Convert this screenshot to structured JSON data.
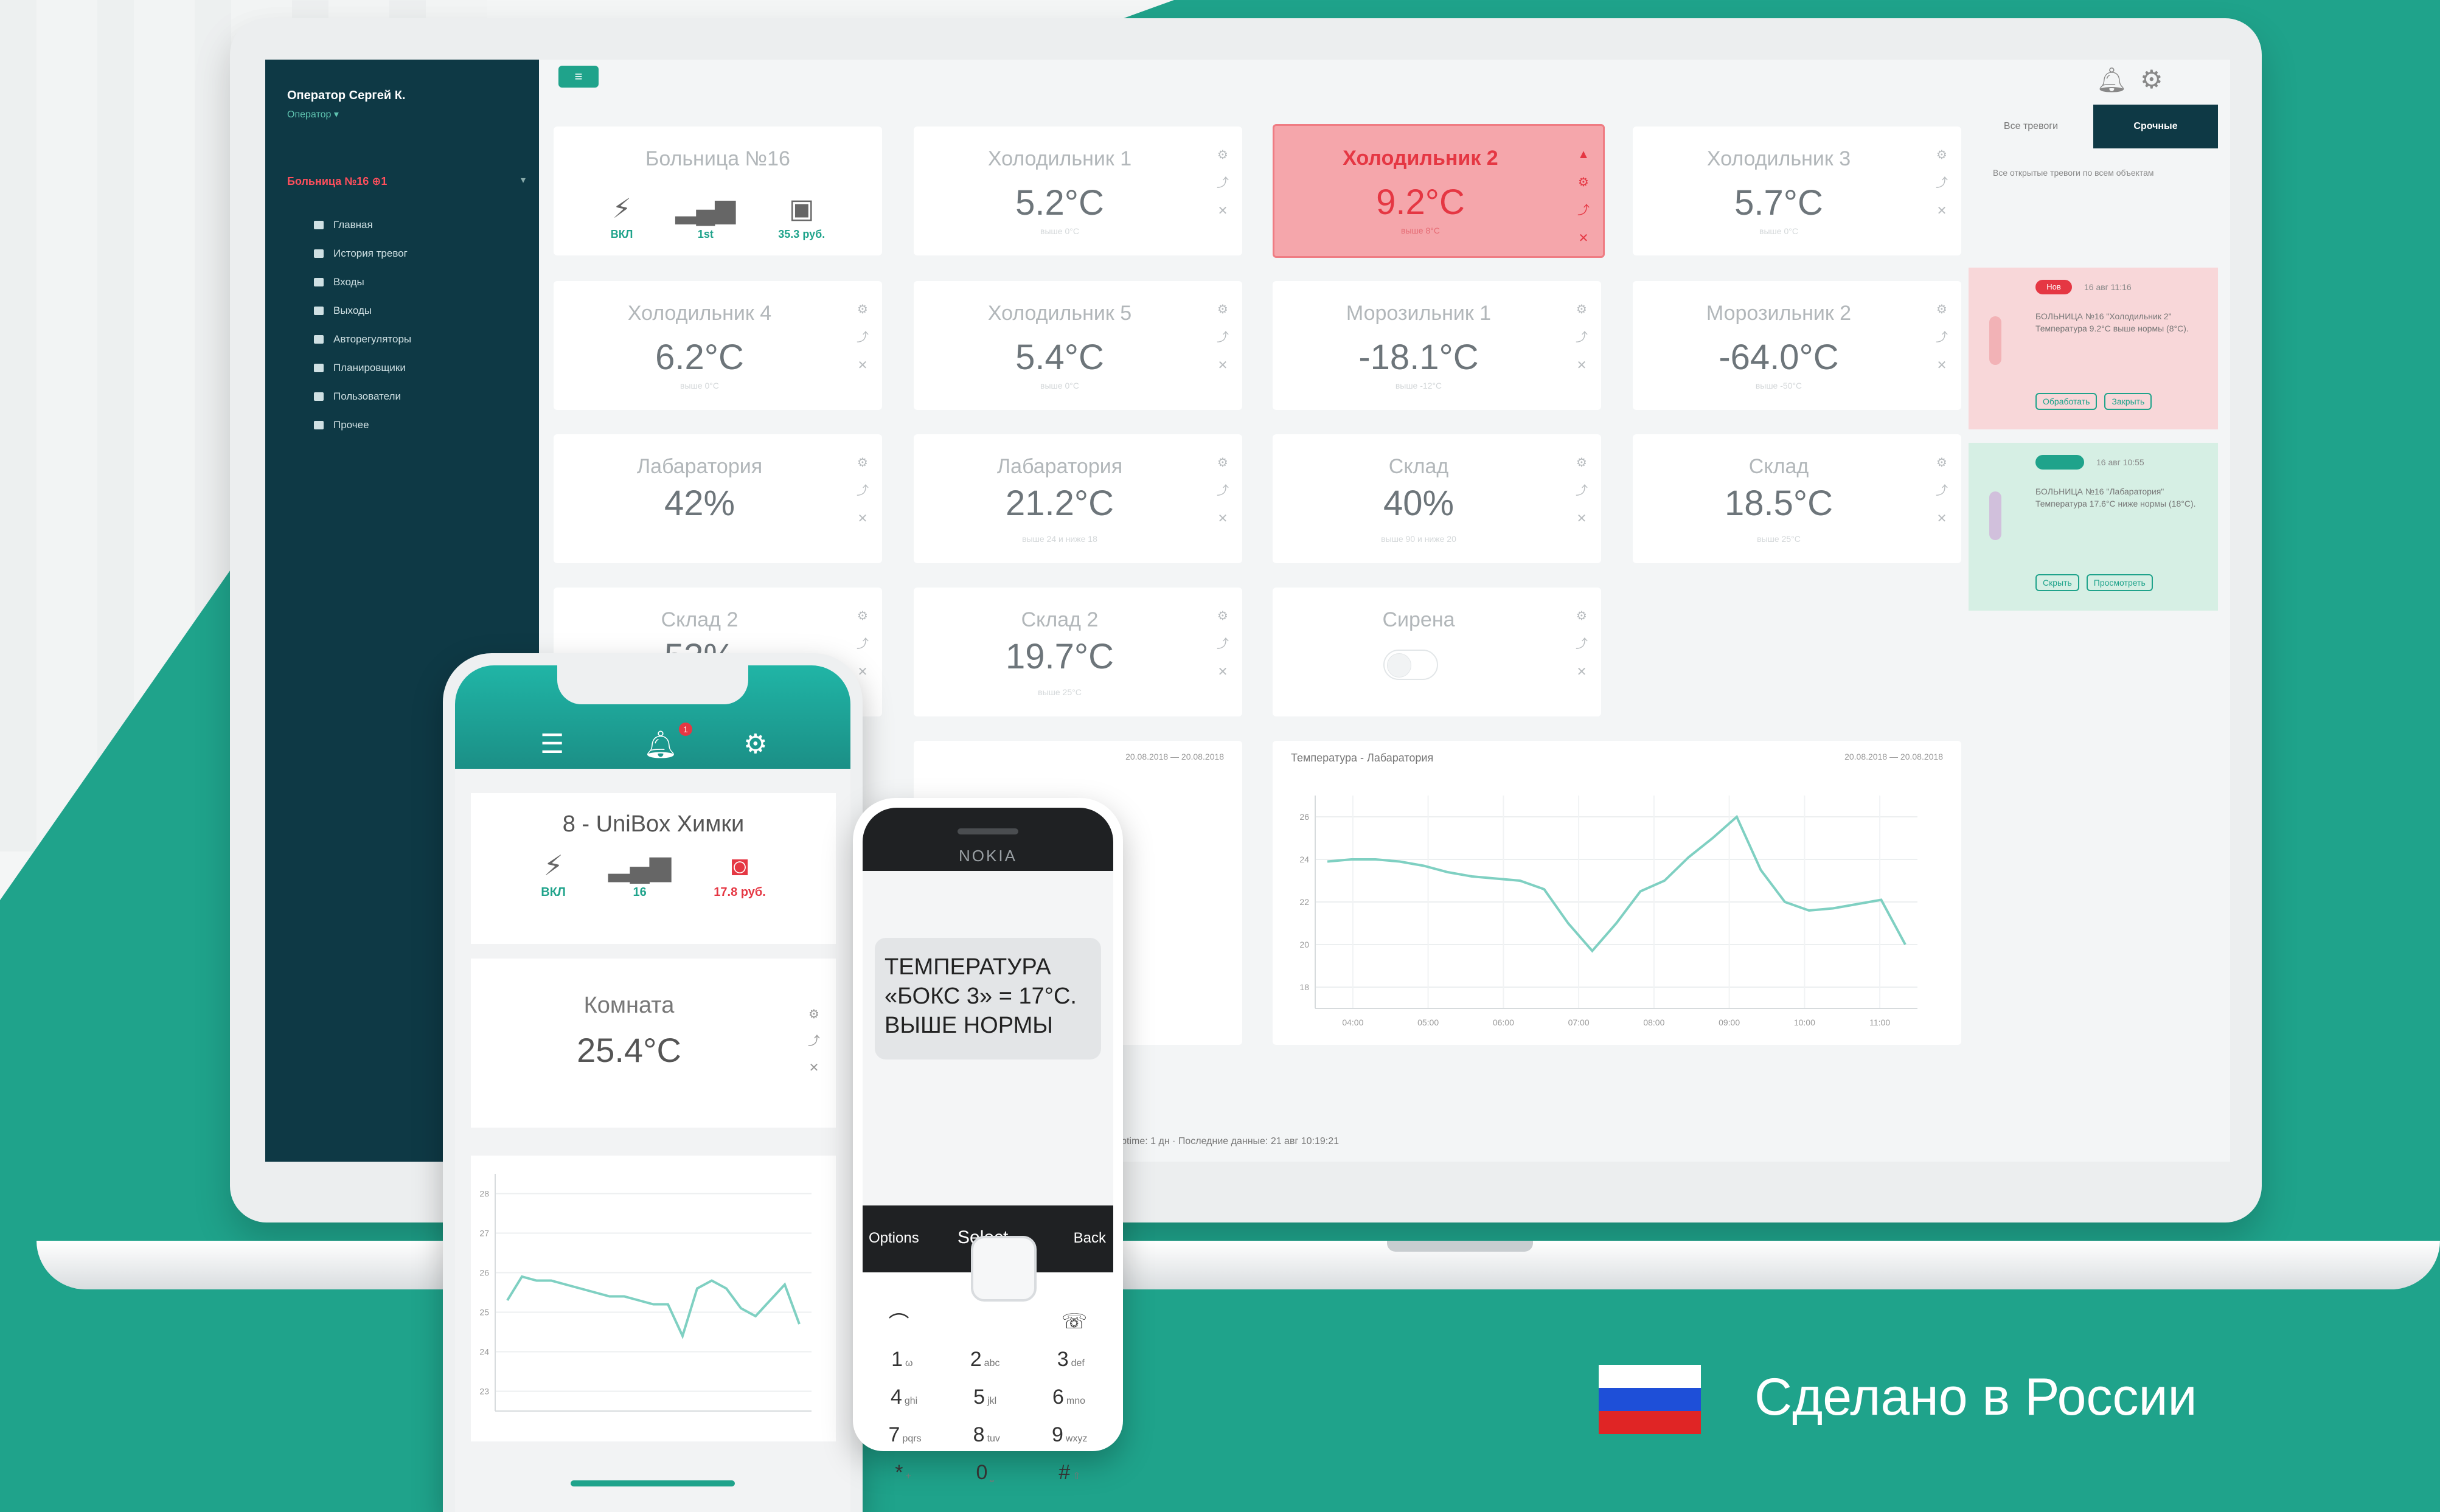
{
  "dashboard": {
    "sidebar": {
      "user": "Оператор Сергей К.",
      "role": "Оператор ▾",
      "org": "Больница №16 ⊕1",
      "menu": [
        "Главная",
        "История тревог",
        "Входы",
        "Выходы",
        "Авторегуляторы",
        "Планировщики",
        "Пользователи",
        "Прочее"
      ]
    },
    "topbar": {
      "menu_button": "≡",
      "bell_icon": "bell-icon",
      "gear_icon": "gear-icon"
    },
    "cards": [
      {
        "title": "Больница №16",
        "type": "hospital",
        "power": "ВКЛ",
        "signal": "1st",
        "balance": "35.3 руб."
      },
      {
        "title": "Холодильник 1",
        "value": "5.2°C",
        "sub": "выше 0°C"
      },
      {
        "title": "Холодильник 2",
        "value": "9.2°C",
        "sub": "выше 8°C",
        "alert": true
      },
      {
        "title": "Холодильник 3",
        "value": "5.7°C",
        "sub": "выше 0°C"
      },
      {
        "title": "Холодильник 4",
        "value": "6.2°C",
        "sub": "выше 0°C"
      },
      {
        "title": "Холодильник 5",
        "value": "5.4°C",
        "sub": "выше 0°C"
      },
      {
        "title": "Морозильник 1",
        "value": "-18.1°C",
        "sub": "выше -12°C"
      },
      {
        "title": "Морозильник 2",
        "value": "-64.0°C",
        "sub": "выше -50°C"
      },
      {
        "title": "Лабаратория",
        "value": "42%",
        "sub": ""
      },
      {
        "title": "Лабаратория",
        "value": "21.2°C",
        "sub": "выше 24 и ниже 18"
      },
      {
        "title": "Склад",
        "value": "40%",
        "sub": "выше 90 и ниже 20"
      },
      {
        "title": "Склад",
        "value": "18.5°C",
        "sub": "выше 25°C"
      },
      {
        "title": "Склад 2",
        "value": "53%",
        "sub": ""
      },
      {
        "title": "Склад 2",
        "value": "19.7°C",
        "sub": "выше 25°C"
      },
      {
        "title": "Сирена",
        "type": "toggle",
        "value": "",
        "sub": ""
      }
    ],
    "notifications": {
      "tab_all": "Все тревоги",
      "tab_urgent": "Срочные",
      "note": "Все открытые тревоги по всем объектам",
      "items": [
        {
          "badge": "Нов",
          "time": "16 авг 11:16",
          "text": "БОЛЬНИЦА №16 \"Холодильник 2\" Температура 9.2°C выше нормы (8°C).",
          "btn1": "Обработать",
          "btn2": "Закрыть",
          "color": "red"
        },
        {
          "badge": "",
          "time": "16 авг 10:55",
          "text": "БОЛЬНИЦА №16 \"Лабаратория\" Температура 17.6°C ниже нормы (18°C).",
          "btn1": "Скрыть",
          "btn2": "Просмотреть",
          "color": "green"
        }
      ]
    },
    "chart_title": "Температура - Лабаратория",
    "chart_dates": "20.08.2018 — 20.08.2018",
    "footer": "48 устройства: 13 · Uptime: 1 дн · Последние данные: 21 авг 10:19:21"
  },
  "phone": {
    "device_title": "8 - UniBox Химки",
    "power": "ВКЛ",
    "signal": "16",
    "balance": "17.8 руб.",
    "room_title": "Комната",
    "room_value": "25.4°C",
    "badge": "1"
  },
  "nokia": {
    "brand": "NOKIA",
    "line1": "ТЕМПЕРАТУРА",
    "line2": "«БОКС 3» = 17°C.",
    "line3": "ВЫШЕ НОРМЫ",
    "soft_left": "Options",
    "soft_mid": "Select",
    "soft_right": "Back",
    "keys": [
      [
        "1",
        "ω"
      ],
      [
        "2",
        "abc"
      ],
      [
        "3",
        "def"
      ],
      [
        "4",
        "ghi"
      ],
      [
        "5",
        "jkl"
      ],
      [
        "6",
        "mno"
      ],
      [
        "7",
        "pqrs"
      ],
      [
        "8",
        "tuv"
      ],
      [
        "9",
        "wxyz"
      ],
      [
        "*",
        "+"
      ],
      [
        "0",
        "⎵"
      ],
      [
        "#",
        "⇧"
      ]
    ]
  },
  "made_in": "Сделано в России",
  "chart_data": [
    {
      "type": "line",
      "title": "Температура - Лабаратория",
      "xlabel": "",
      "ylabel": "",
      "x": [
        "04:00",
        "05:00",
        "06:00",
        "07:00",
        "08:00",
        "09:00",
        "10:00",
        "11:00"
      ],
      "ylim": [
        17,
        27
      ],
      "yticks": [
        18,
        20,
        22,
        24,
        26
      ],
      "series": [
        {
          "values": [
            23.9,
            24.0,
            24.0,
            23.9,
            23.7,
            23.4,
            23.2,
            23.1,
            23.0,
            22.6,
            21.0,
            19.7,
            21.0,
            22.5,
            23.0,
            24.1,
            25.0,
            26.0,
            23.5,
            22.0,
            21.6,
            21.7,
            21.9,
            22.1,
            20.0
          ]
        }
      ]
    },
    {
      "type": "line",
      "title": "",
      "xlabel": "",
      "ylabel": "",
      "ylim": [
        22.5,
        28.5
      ],
      "yticks": [
        23,
        24,
        25,
        26,
        27,
        28
      ],
      "series": [
        {
          "values": [
            25.3,
            25.9,
            25.8,
            25.8,
            25.7,
            25.6,
            25.5,
            25.4,
            25.4,
            25.3,
            25.2,
            25.2,
            24.4,
            25.6,
            25.8,
            25.6,
            25.1,
            24.9,
            25.3,
            25.7,
            24.7
          ]
        }
      ]
    }
  ]
}
